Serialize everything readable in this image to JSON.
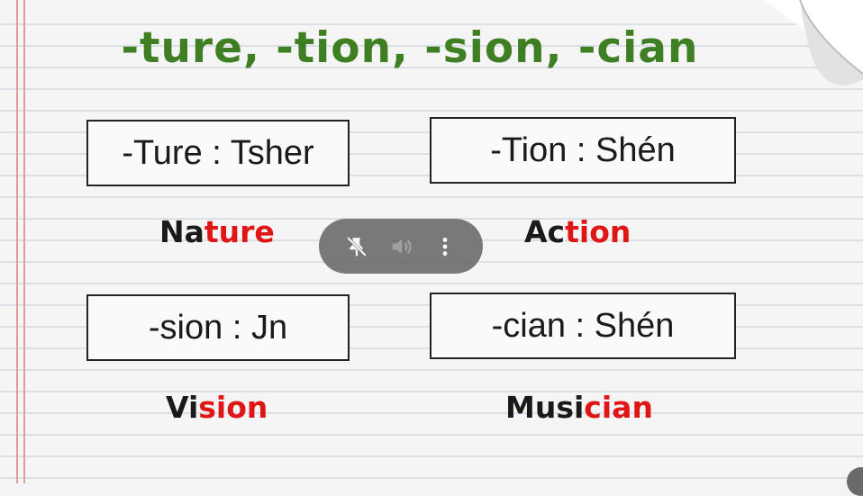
{
  "title": "-ture, -tion, -sion, -cian",
  "rules": [
    {
      "text": "-Ture : Tsher"
    },
    {
      "text": "-Tion : Shén"
    },
    {
      "text": "-sion : Jn"
    },
    {
      "text": "-cian : Shén"
    }
  ],
  "examples": [
    {
      "stem": "Na",
      "suffix": "ture"
    },
    {
      "stem": "Ac",
      "suffix": "tion"
    },
    {
      "stem": "Vi",
      "suffix": "sion"
    },
    {
      "stem": "Musi",
      "suffix": "cian"
    }
  ],
  "controls": {
    "icons": [
      "pin-off-icon",
      "volume-icon",
      "more-vert-icon"
    ]
  },
  "colors": {
    "title": "#3f7f24",
    "suffix": "#e01515",
    "text": "#1a1a1a",
    "margin_line": "#e59a9a"
  }
}
